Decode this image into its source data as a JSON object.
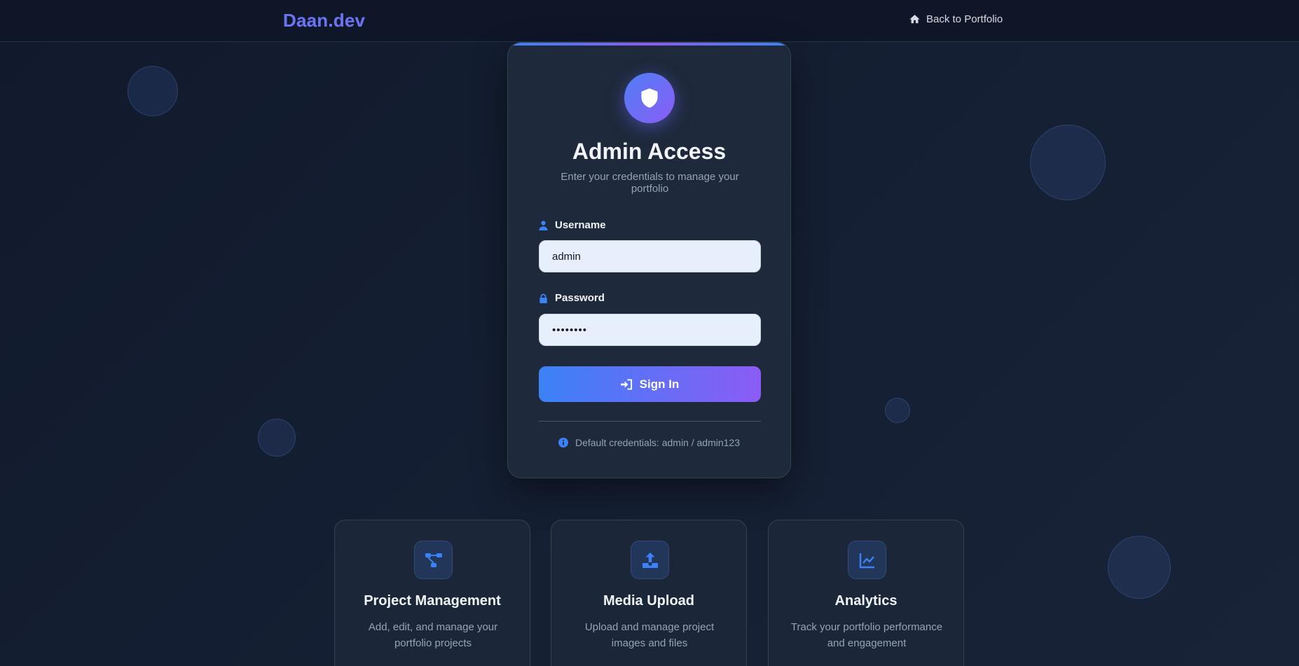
{
  "nav": {
    "logo": "Daan.dev",
    "back_link": "Back to Portfolio"
  },
  "login": {
    "title": "Admin Access",
    "subtitle": "Enter your credentials to manage your portfolio",
    "username_label": "Username",
    "username_value": "admin",
    "password_label": "Password",
    "password_value": "••••••••",
    "signin_label": "Sign In",
    "hint": "Default credentials: admin / admin123"
  },
  "features": [
    {
      "title": "Project Management",
      "description": "Add, edit, and manage your portfolio projects",
      "icon": "project-diagram-icon"
    },
    {
      "title": "Media Upload",
      "description": "Upload and manage project images and files",
      "icon": "upload-icon"
    },
    {
      "title": "Analytics",
      "description": "Track your portfolio performance and engagement",
      "icon": "chart-line-icon"
    }
  ],
  "colors": {
    "accent_blue": "#3b82f6",
    "accent_purple": "#8b5cf6",
    "background": "#111a2c",
    "card": "#1e293b"
  }
}
